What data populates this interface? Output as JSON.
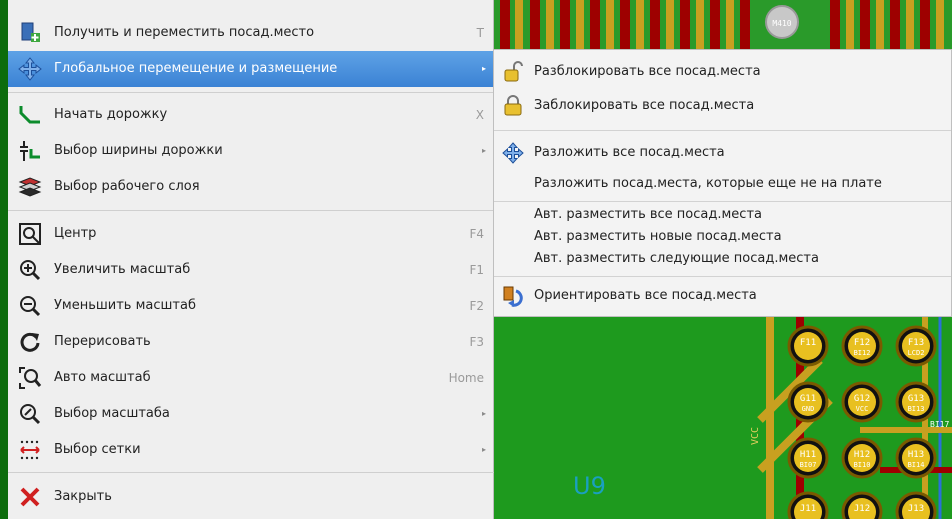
{
  "context_menu": {
    "items": [
      {
        "label": "Получить и переместить посад.место",
        "shortcut": "T"
      },
      {
        "label": "Глобальное перемещение и размещение",
        "submenu": true,
        "highlighted": true
      },
      {
        "label": "Начать дорожку",
        "shortcut": "X"
      },
      {
        "label": "Выбор ширины дорожки",
        "submenu": true
      },
      {
        "label": "Выбор рабочего слоя"
      },
      {
        "label": "Центр",
        "shortcut": "F4"
      },
      {
        "label": "Увеличить масштаб",
        "shortcut": "F1"
      },
      {
        "label": "Уменьшить масштаб",
        "shortcut": "F2"
      },
      {
        "label": "Перерисовать",
        "shortcut": "F3"
      },
      {
        "label": "Авто масштаб",
        "shortcut": "Home"
      },
      {
        "label": "Выбор масштаба",
        "submenu": true
      },
      {
        "label": "Выбор сетки",
        "submenu": true
      },
      {
        "label": "Закрыть"
      }
    ],
    "submenu_arrow": "▸"
  },
  "submenu": {
    "items": [
      {
        "label": "Разблокировать все посад.места",
        "icon": "unlock-icon"
      },
      {
        "label": "Заблокировать все посад.места",
        "icon": "lock-icon"
      },
      {
        "label": "Разложить все посад.места",
        "icon": "move-arrows-icon"
      },
      {
        "label": "Разложить посад.места, которые еще не на плате"
      },
      {
        "label": "Авт. разместить все посад.места"
      },
      {
        "label": "Авт. разместить новые посад.места"
      },
      {
        "label": "Авт. разместить следующие посад.места"
      },
      {
        "label": "Ориентировать все посад.места",
        "icon": "orient-icon"
      }
    ]
  },
  "pcb": {
    "designator": "U9",
    "net_label": "VCC",
    "pads": [
      {
        "name": "F11",
        "net": ""
      },
      {
        "name": "F12",
        "net": "BI12"
      },
      {
        "name": "F13",
        "net": "LCD2"
      },
      {
        "name": "G11",
        "net": "GND"
      },
      {
        "name": "G12",
        "net": "VCC"
      },
      {
        "name": "G13",
        "net": "BI13"
      },
      {
        "name": "H11",
        "net": "BI07"
      },
      {
        "name": "H12",
        "net": "BI10"
      },
      {
        "name": "H13",
        "net": "BI14"
      },
      {
        "name": "J11",
        "net": ""
      },
      {
        "name": "J12",
        "net": ""
      },
      {
        "name": "J13",
        "net": ""
      }
    ],
    "trace_label": "BI17",
    "top_pad_label": "M410",
    "colors": {
      "board": "#1a8c1a",
      "copper": "#c8a020",
      "trace_red": "#b00000",
      "pad": "#e8c020",
      "accent": "#3b82d4"
    }
  }
}
